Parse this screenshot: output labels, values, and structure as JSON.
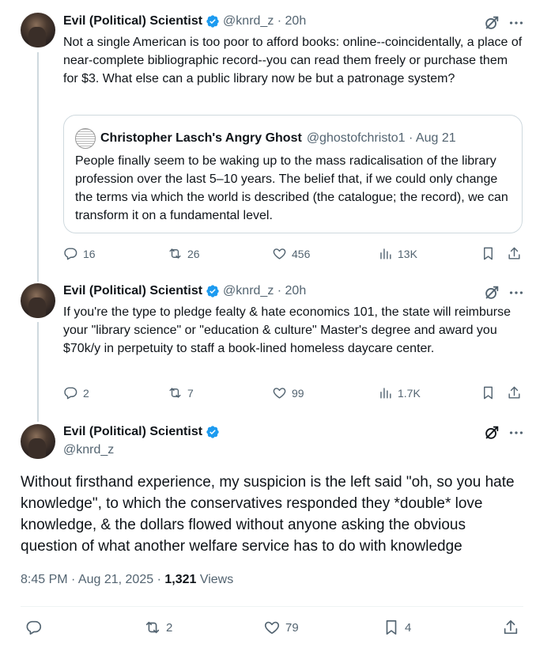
{
  "tweet1": {
    "name": "Evil (Political) Scientist",
    "handle_time": "@knrd_z · 20h",
    "text": "Not a single American is too poor to afford books: online--coincidentally, a place of near-complete bibliographic record--you can read them freely or purchase them for $3. What else can a public library now be but a patronage system?",
    "quote": {
      "name": "Christopher Lasch's Angry Ghost",
      "handle_time": "@ghostofchristo1 · Aug 21",
      "text": "People finally seem to be waking up to the mass radicalisation of the library profession over the last 5–10 years. The belief that, if we could only change the terms via which the world is described (the catalogue; the record), we can transform it on a fundamental level."
    },
    "replies": "16",
    "reposts": "26",
    "likes": "456",
    "views": "13K"
  },
  "tweet2": {
    "name": "Evil (Political) Scientist",
    "handle_time": "@knrd_z · 20h",
    "text": "If you're the type to pledge fealty & hate economics 101, the state will reimburse your \"library science\" or \"education & culture\" Master's degree and award you $70k/y in perpetuity to staff a book-lined homeless daycare center.",
    "replies": "2",
    "reposts": "7",
    "likes": "99",
    "views": "1.7K"
  },
  "main": {
    "name": "Evil (Political) Scientist",
    "handle": "@knrd_z",
    "text": "Without firsthand experience, my suspicion is the left said \"oh, so you hate knowledge\", to which the conservatives responded they *double* love knowledge, & the dollars flowed without anyone asking the obvious question of what another welfare service has to do with knowledge",
    "time": "8:45 PM · Aug 21, 2025 · ",
    "views_count": "1,321",
    "views_label": " Views",
    "reposts": "2",
    "likes": "79",
    "bookmarks": "4"
  },
  "colors": {
    "verified": "#1d9bf0",
    "muted": "#536471",
    "border": "#cfd9de"
  },
  "icons": [
    "grok-icon",
    "more-icon",
    "reply-icon",
    "repost-icon",
    "like-icon",
    "views-icon",
    "bookmark-icon",
    "share-icon",
    "verified-icon"
  ]
}
